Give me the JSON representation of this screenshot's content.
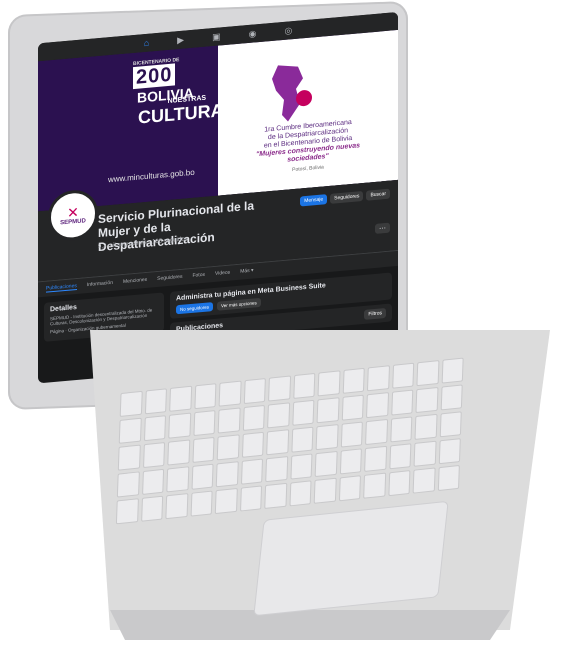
{
  "topbar": {
    "icons": [
      "home-icon",
      "video-icon",
      "marketplace-icon",
      "groups-icon",
      "gaming-icon"
    ]
  },
  "cover": {
    "year_label": "200",
    "brand_country": "BOLIVIA",
    "brand_tiny": "BICENTENARIO DE",
    "cultures_top": "NUESTRAS",
    "cultures_main": "CULTURAS",
    "url": "www.minculturas.gob.bo",
    "summit_lines": [
      "1ra Cumbre Iberoamericana",
      "de la Despatriarcalización",
      "en el Bicentenario de Bolivia"
    ],
    "summit_quote": "\"Mujeres construyendo nuevas sociedades\"",
    "summit_place": "Potosí, Bolivia"
  },
  "profile": {
    "avatar_logo": "SEPMUD",
    "name": "Servicio Plurinacional de la Mujer y de la Despatriarcalización",
    "stats": "9,3 mil seguidores · 185 seguidos",
    "buttons": [
      "Mensaje",
      "Seguidores",
      "Buscar"
    ],
    "more": "⋯"
  },
  "tabs": [
    "Publicaciones",
    "Información",
    "Menciones",
    "Seguidores",
    "Fotos",
    "Videos",
    "Más ▾"
  ],
  "details": {
    "title": "Detalles",
    "description": "SEPMUD - Institución descentralizada del Mtrio. de Culturas, Descolonización y Despatriarcalización",
    "page_type": "Página · Organización gubernamental"
  },
  "manage": {
    "title": "Administra tu página en Meta Business Suite",
    "primary": "No seguidores",
    "secondary": "Ver más opciones",
    "filter": "Filtros"
  },
  "posts": {
    "title": "Publicaciones"
  }
}
